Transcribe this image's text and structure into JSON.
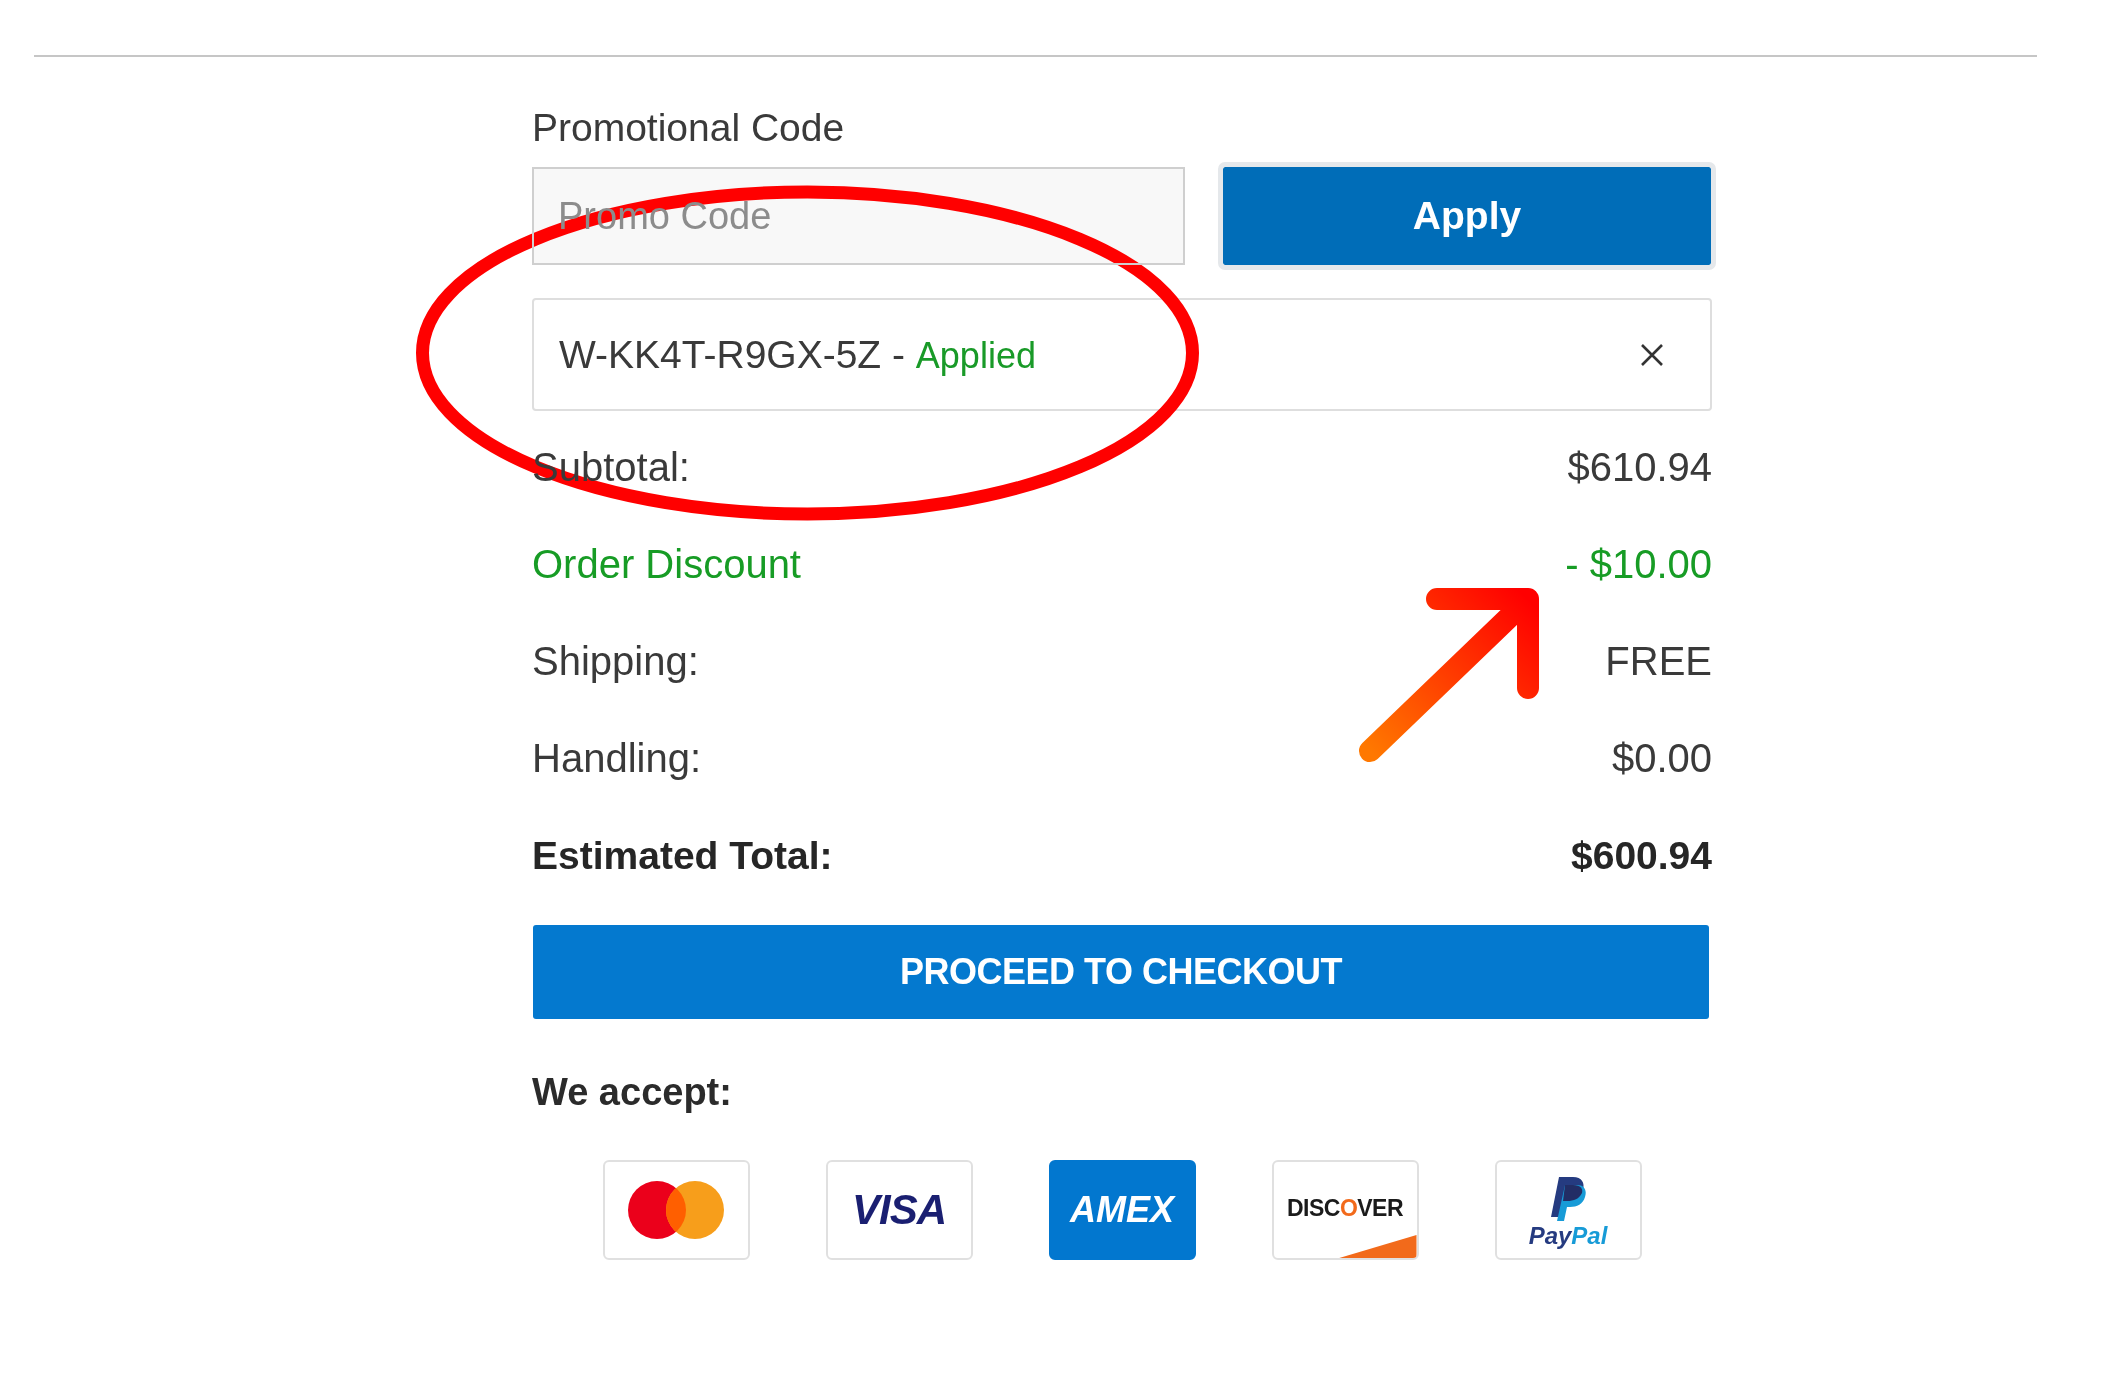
{
  "promo": {
    "label": "Promotional Code",
    "placeholder": "Promo Code",
    "apply_button": "Apply"
  },
  "applied_code": {
    "code": "W-KK4T-R9GX-5Z -",
    "status": "Applied",
    "circled": true
  },
  "summary": [
    {
      "kind": "line",
      "label": "Subtotal:",
      "value": "$610.94"
    },
    {
      "kind": "discount",
      "label": "Order Discount",
      "value": "- $10.00"
    },
    {
      "kind": "line",
      "label": "Shipping:",
      "value": "FREE"
    },
    {
      "kind": "line",
      "label": "Handling:",
      "value": "$0.00"
    },
    {
      "kind": "total",
      "label": "Estimated Total:",
      "value": "$600.94"
    }
  ],
  "checkout_button": "PROCEED TO CHECKOUT",
  "payment": {
    "label": "We accept:",
    "cards": [
      {
        "kind": "mastercard"
      },
      {
        "kind": "visa",
        "text": "VISA"
      },
      {
        "kind": "amex",
        "text": "AMEX"
      },
      {
        "kind": "discover",
        "text": "DISCOVER"
      },
      {
        "kind": "paypal",
        "text": "PayPal"
      }
    ]
  },
  "annotation_arrow": true
}
